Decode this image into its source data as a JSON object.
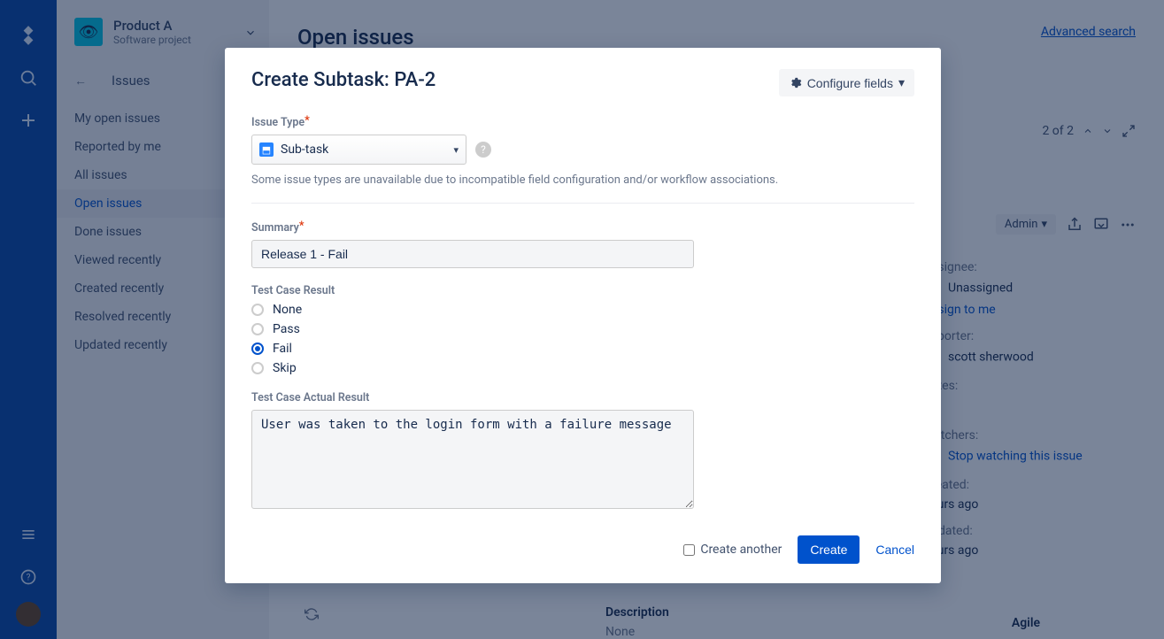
{
  "project": {
    "name": "Product A",
    "subtitle": "Software project"
  },
  "nav": {
    "back_label": "Issues"
  },
  "filters": [
    {
      "label": "My open issues",
      "active": false
    },
    {
      "label": "Reported by me",
      "active": false
    },
    {
      "label": "All issues",
      "active": false
    },
    {
      "label": "Open issues",
      "active": true
    },
    {
      "label": "Done issues",
      "active": false
    },
    {
      "label": "Viewed recently",
      "active": false
    },
    {
      "label": "Created recently",
      "active": false
    },
    {
      "label": "Resolved recently",
      "active": false
    },
    {
      "label": "Updated recently",
      "active": false
    }
  ],
  "page": {
    "heading": "Open issues",
    "advanced_search": "Advanced search",
    "pager": "2 of 2"
  },
  "toolbar": {
    "admin_label": "Admin"
  },
  "issue": {
    "assignee_label": "Assignee:",
    "assignee_value": "Unassigned",
    "assign_to_me": "Assign to me",
    "reporter_label": "Reporter:",
    "reporter_value": "scott sherwood",
    "votes_label": "Votes:",
    "watchers_label": "Watchers:",
    "watchers_action": "Stop watching this issue",
    "created_label": "Created:",
    "created_value": "hours ago",
    "updated_label": "Updated:",
    "updated_value": "hours ago",
    "description_label": "Description",
    "description_value": "None",
    "agile_label": "Agile"
  },
  "modal": {
    "title": "Create Subtask: PA-2",
    "configure_fields": "Configure fields",
    "issue_type_label": "Issue Type",
    "issue_type_value": "Sub-task",
    "issue_type_hint": "Some issue types are unavailable due to incompatible field configuration and/or workflow associations.",
    "summary_label": "Summary",
    "summary_value": "Release 1 - Fail",
    "test_result_label": "Test Case Result",
    "test_result_options": [
      "None",
      "Pass",
      "Fail",
      "Skip"
    ],
    "test_result_selected": "Fail",
    "actual_result_label": "Test Case Actual Result",
    "actual_result_value": "User was taken to the login form with a failure message",
    "create_another": "Create another",
    "create": "Create",
    "cancel": "Cancel"
  }
}
